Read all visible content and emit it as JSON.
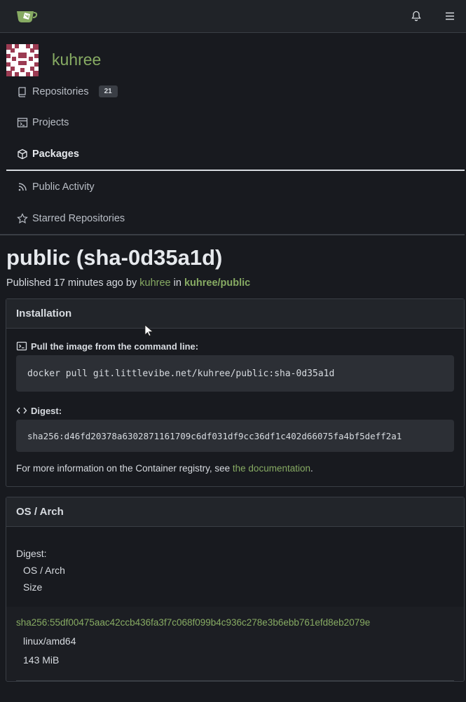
{
  "nav": {
    "logo": "gitea-logo",
    "right_icons": [
      "bell-icon",
      "hamburger-menu-icon"
    ]
  },
  "profile": {
    "username": "kuhree"
  },
  "tabs": [
    {
      "label": "Repositories",
      "count": "21",
      "icon": "repo-icon"
    },
    {
      "label": "Projects",
      "icon": "project-icon"
    },
    {
      "label": "Packages",
      "icon": "package-icon",
      "active": true
    },
    {
      "label": "Public Activity",
      "icon": "rss-icon"
    },
    {
      "label": "Starred Repositories",
      "icon": "star-icon"
    }
  ],
  "package": {
    "title": "public (sha-0d35a1d)",
    "published_prefix": "Published",
    "time_ago": "17 minutes ago",
    "by": "by",
    "author": "kuhree",
    "in": "in",
    "repo": "kuhree/public"
  },
  "installation": {
    "header": "Installation",
    "pull_label": "Pull the image from the command line:",
    "pull_command": "docker pull git.littlevibe.net/kuhree/public:sha-0d35a1d",
    "digest_label": "Digest:",
    "digest_value": "sha256:d46fd20378a6302871161709c6df031df9cc36df1c402d66075fa4bf5deff2a1",
    "info_prefix": "For more information on the Container registry, see",
    "info_link": "the documentation",
    "info_suffix": "."
  },
  "os_arch": {
    "header": "OS / Arch",
    "col_digest": "Digest:",
    "col_osarch": "OS / Arch",
    "col_size": "Size",
    "rows": [
      {
        "digest": "sha256:55df00475aac42ccb436fa3f7c068f099b4c936c278e3b6ebb761efd8eb2079e",
        "osarch": "linux/amd64",
        "size": "143 MiB"
      }
    ]
  },
  "colors": {
    "accent": "#87ab63",
    "background": "#181a1f",
    "surface": "#202328",
    "border": "#3a3e45"
  }
}
